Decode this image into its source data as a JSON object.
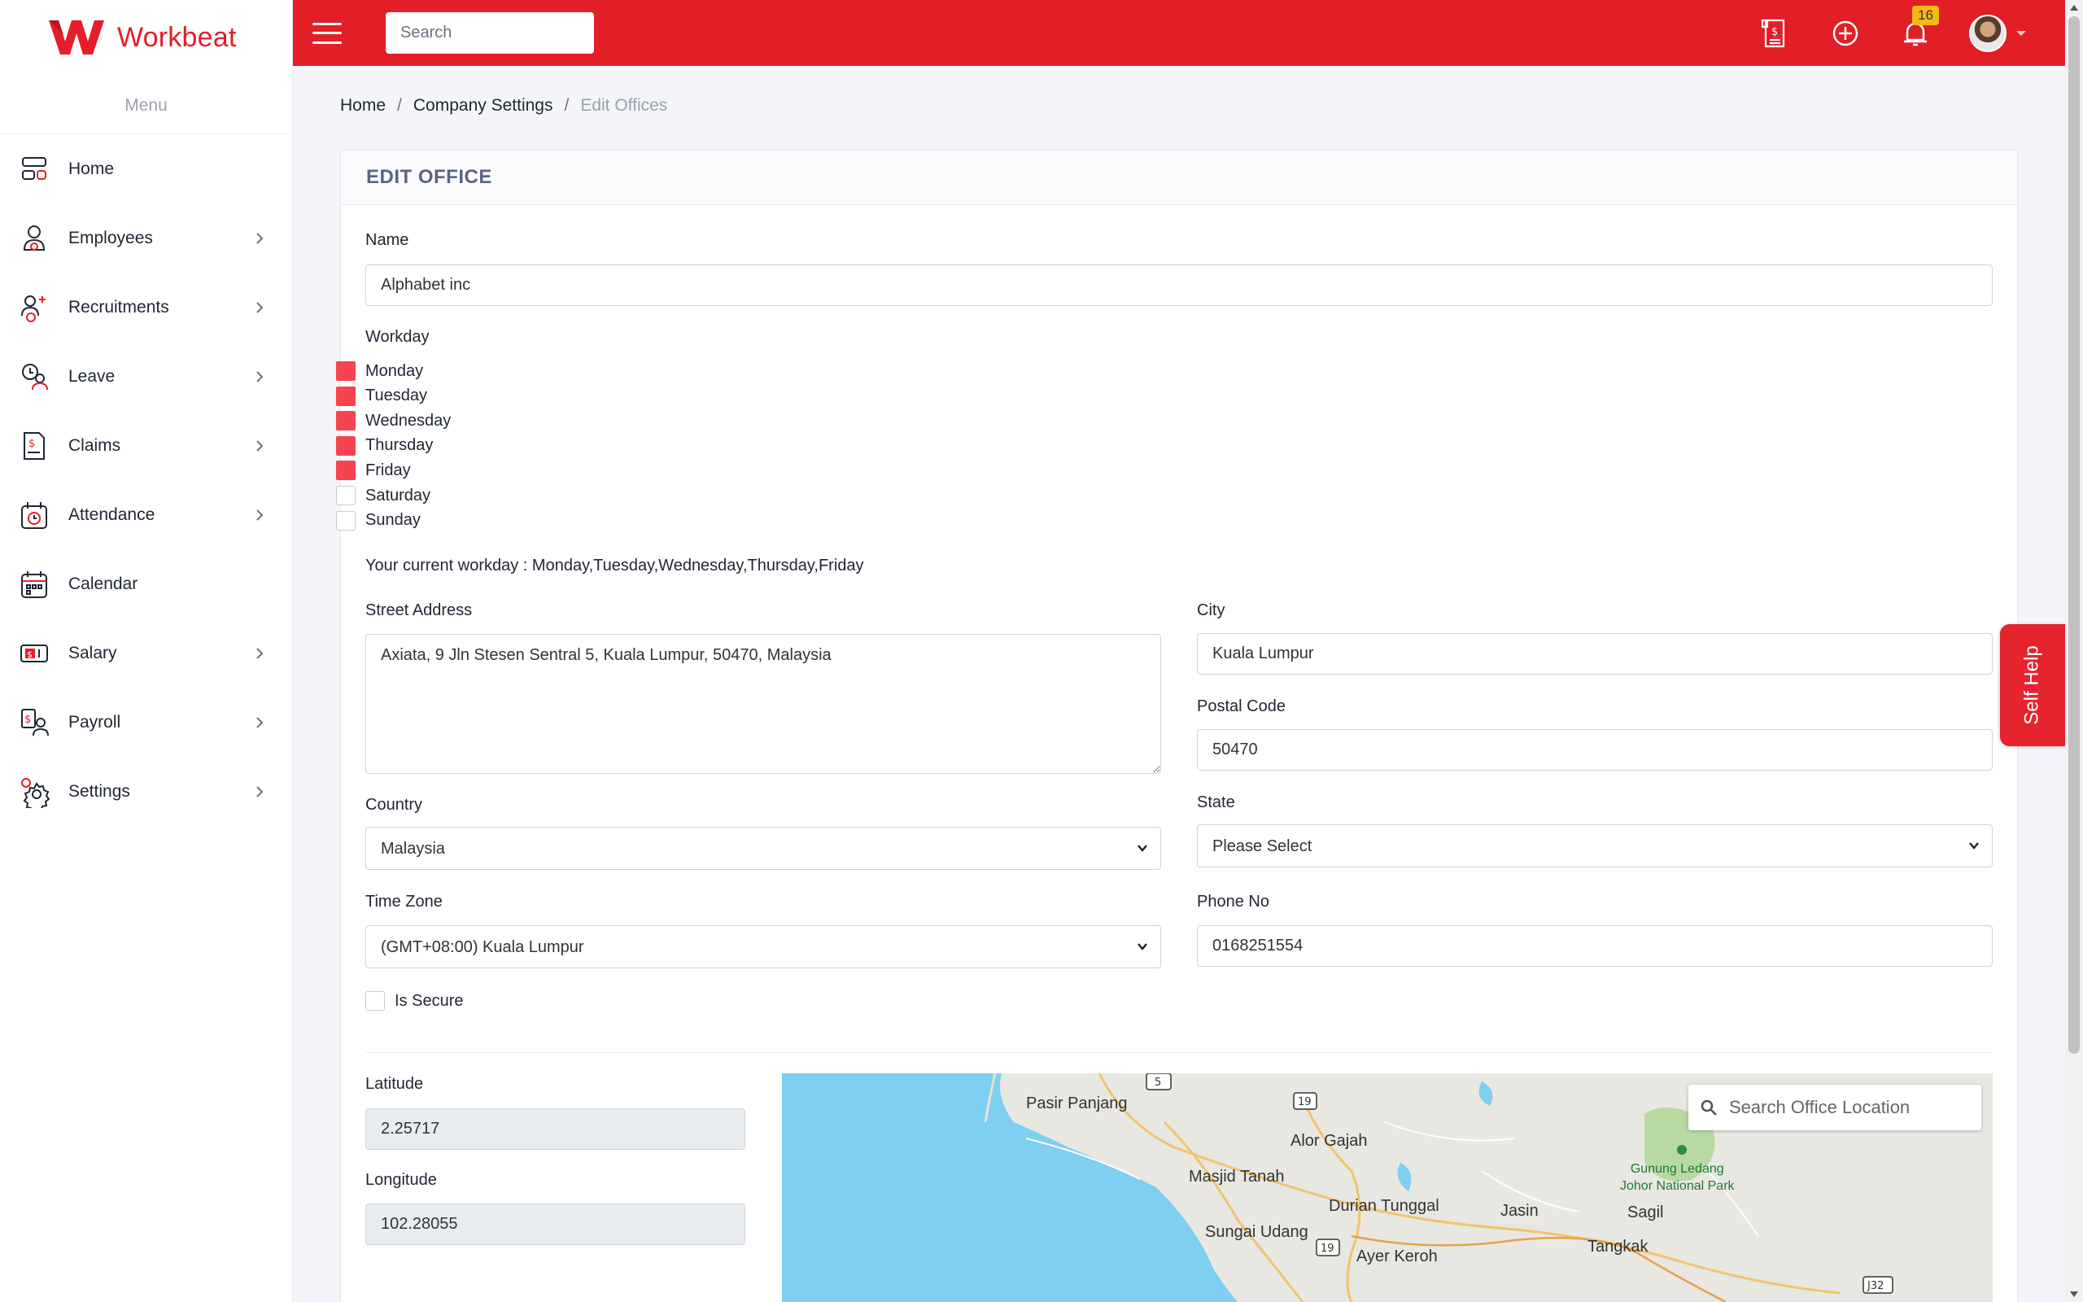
{
  "app": {
    "name": "Workbeat",
    "brand_color": "#e21e27"
  },
  "topbar": {
    "search_placeholder": "Search",
    "notification_count": "16",
    "icons": [
      "payslip-icon",
      "add-circle-icon",
      "bell-icon",
      "avatar"
    ]
  },
  "sidebar": {
    "menu_label": "Menu",
    "items": [
      {
        "label": "Home",
        "icon": "home-icon",
        "has_submenu": false
      },
      {
        "label": "Employees",
        "icon": "employees-icon",
        "has_submenu": true
      },
      {
        "label": "Recruitments",
        "icon": "recruitments-icon",
        "has_submenu": true
      },
      {
        "label": "Leave",
        "icon": "leave-icon",
        "has_submenu": true
      },
      {
        "label": "Claims",
        "icon": "claims-icon",
        "has_submenu": true
      },
      {
        "label": "Attendance",
        "icon": "attendance-icon",
        "has_submenu": true
      },
      {
        "label": "Calendar",
        "icon": "calendar-icon",
        "has_submenu": false
      },
      {
        "label": "Salary",
        "icon": "salary-icon",
        "has_submenu": true
      },
      {
        "label": "Payroll",
        "icon": "payroll-icon",
        "has_submenu": true
      },
      {
        "label": "Settings",
        "icon": "settings-icon",
        "has_submenu": true
      }
    ]
  },
  "breadcrumb": {
    "home": "Home",
    "sep": "/",
    "company_settings": "Company Settings",
    "current": "Edit Offices"
  },
  "form": {
    "title": "EDIT OFFICE",
    "name_label": "Name",
    "name_value": "Alphabet inc",
    "workday_label": "Workday",
    "days": [
      {
        "label": "Monday",
        "checked": true
      },
      {
        "label": "Tuesday",
        "checked": true
      },
      {
        "label": "Wednesday",
        "checked": true
      },
      {
        "label": "Thursday",
        "checked": true
      },
      {
        "label": "Friday",
        "checked": true
      },
      {
        "label": "Saturday",
        "checked": false
      },
      {
        "label": "Sunday",
        "checked": false
      }
    ],
    "current_workday_text": "Your current workday : Monday,Tuesday,Wednesday,Thursday,Friday",
    "street_label": "Street Address",
    "street_value": "Axiata, 9 Jln Stesen Sentral 5, Kuala Lumpur, 50470, Malaysia",
    "city_label": "City",
    "city_value": "Kuala Lumpur",
    "postal_label": "Postal Code",
    "postal_value": "50470",
    "country_label": "Country",
    "country_value": "Malaysia",
    "state_label": "State",
    "state_value": "Please Select",
    "timezone_label": "Time Zone",
    "timezone_value": "(GMT+08:00) Kuala Lumpur",
    "phone_label": "Phone No",
    "phone_value": "0168251554",
    "secure_label": "Is Secure",
    "secure_checked": false,
    "latitude_label": "Latitude",
    "latitude_value": "2.25717",
    "longitude_label": "Longitude",
    "longitude_value": "102.28055"
  },
  "map": {
    "search_placeholder": "Search Office Location",
    "places": [
      "Pasir Panjang",
      "Alor Gajah",
      "Masjid Tanah",
      "Durian Tunggal",
      "Jasin",
      "Sungai Udang",
      "Ayer Keroh",
      "Tangkak",
      "Sagil"
    ],
    "park_line1": "Gunung Ledang",
    "park_line2": "Johor National Park",
    "road_markers": [
      "5",
      "19",
      "19",
      "J32"
    ]
  },
  "self_help": "Self Help"
}
